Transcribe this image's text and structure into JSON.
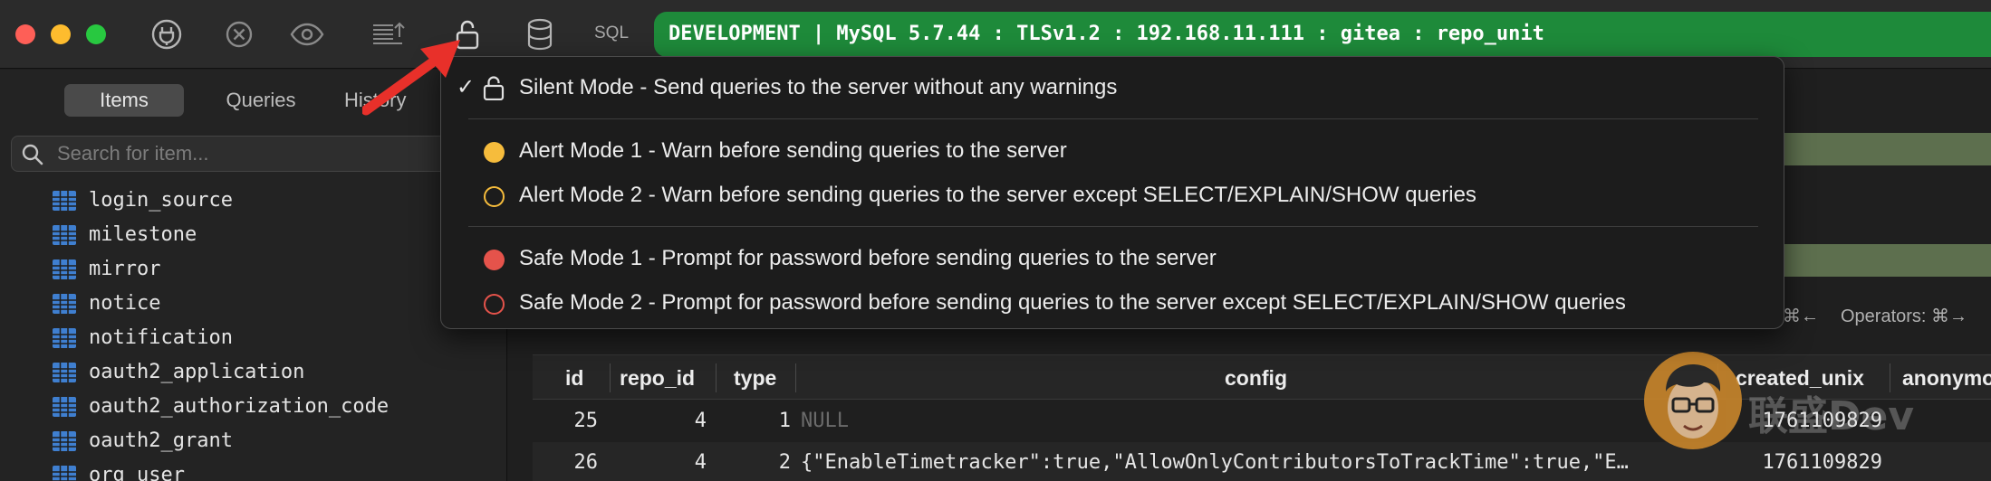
{
  "titlebar": {
    "sql_label": "SQL",
    "connection": "DEVELOPMENT | MySQL 5.7.44 : TLSv1.2 : 192.168.11.111 : gitea : repo_unit",
    "connection_color": "#1e8a3a"
  },
  "sidebar": {
    "tabs": [
      "Items",
      "Queries",
      "History"
    ],
    "search_placeholder": "Search for item...",
    "tables": [
      "login_source",
      "milestone",
      "mirror",
      "notice",
      "notification",
      "oauth2_application",
      "oauth2_authorization_code",
      "oauth2_grant",
      "org_user"
    ]
  },
  "safe_mode_menu": {
    "items": [
      {
        "label": "Silent Mode - Send queries to the server without any warnings",
        "checked": true,
        "indicator": "lock-open-icon"
      },
      {
        "label": "Alert Mode 1 - Warn before sending queries to the server",
        "checked": false,
        "indicator": "yellow-filled"
      },
      {
        "label": "Alert Mode 2 - Warn before sending queries to the server except SELECT/EXPLAIN/SHOW queries",
        "checked": false,
        "indicator": "yellow-outline"
      },
      {
        "label": "Safe Mode 1 - Prompt for password before sending queries to the server",
        "checked": false,
        "indicator": "red-filled"
      },
      {
        "label": "Safe Mode 2 - Prompt for password before sending queries to the server except SELECT/EXPLAIN/SHOW queries",
        "checked": false,
        "indicator": "red-outline"
      }
    ],
    "checkmark": "✓"
  },
  "toolbar": {
    "shortcut_partial": "⌘←",
    "operators_label": "Operators: ⌘→"
  },
  "grid": {
    "columns": [
      "id",
      "repo_id",
      "type",
      "config",
      "created_unix",
      "anonymo"
    ],
    "rows": [
      {
        "id": "25",
        "repo_id": "4",
        "type": "1",
        "config": "NULL",
        "created_unix": "1761109829"
      },
      {
        "id": "26",
        "repo_id": "4",
        "type": "2",
        "config": "{\"EnableTimetracker\":true,\"AllowOnlyContributorsToTrackTime\":true,\"E…",
        "created_unix": "1761109829"
      }
    ]
  },
  "watermark": {
    "text": "联盛Dev"
  },
  "colors": {
    "annotation_arrow": "#e8302a",
    "alert_yellow": "#f6bc3c",
    "safe_red": "#e5534b"
  }
}
